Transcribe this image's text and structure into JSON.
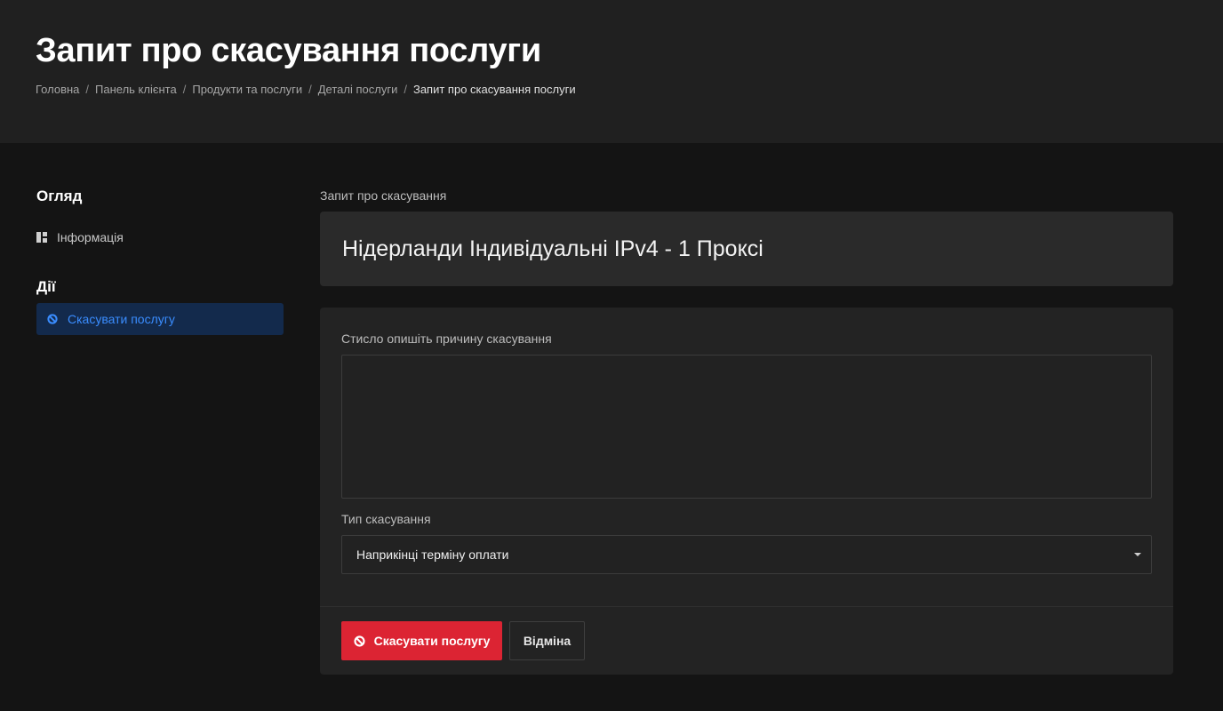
{
  "header": {
    "title": "Запит про скасування послуги",
    "breadcrumb": [
      {
        "label": "Головна"
      },
      {
        "label": "Панель клієнта"
      },
      {
        "label": "Продукти та послуги"
      },
      {
        "label": "Деталі послуги"
      },
      {
        "label": "Запит про скасування послуги"
      }
    ]
  },
  "sidebar": {
    "overview_heading": "Огляд",
    "overview_items": [
      {
        "label": "Інформація",
        "icon": "dashboard-icon"
      }
    ],
    "actions_heading": "Дії",
    "action_items": [
      {
        "label": "Скасувати послугу",
        "icon": "ban-icon"
      }
    ]
  },
  "main": {
    "section_label": "Запит про скасування",
    "product_name": "Нідерланди Індивідуальні IPv4 - 1 Проксі",
    "reason_label": "Стисло опишіть причину скасування",
    "reason_value": "",
    "type_label": "Тип скасування",
    "type_value": "Наприкінці терміну оплати",
    "submit_label": "Скасувати послугу",
    "cancel_label": "Відміна"
  },
  "colors": {
    "accent_blue": "#3a8dff",
    "danger_red": "#dc2433",
    "active_bg": "#132a4c"
  }
}
